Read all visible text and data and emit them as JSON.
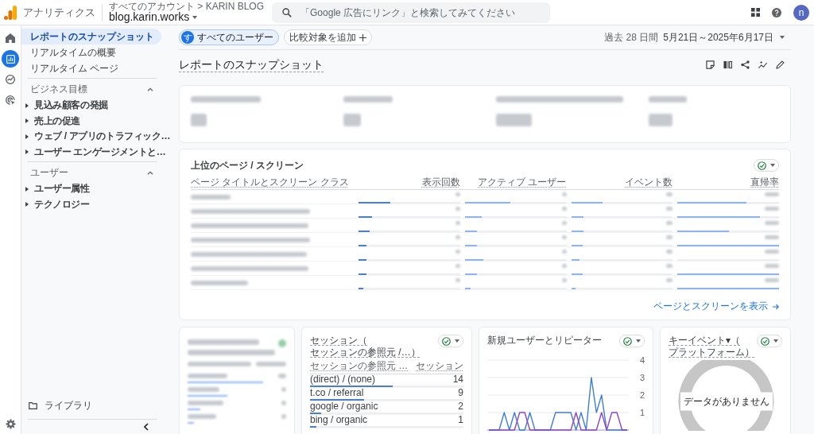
{
  "top_bar": {
    "product": "アナリティクス",
    "account_path": "すべてのアカウント > KARIN BLOG",
    "property": "blog.karin.works",
    "search": {
      "placeholder": "「Google 広告にリンク」と検索してみてください"
    },
    "avatar_letter": "n"
  },
  "rail": {
    "items": [
      {
        "kind": "home",
        "selected": false
      },
      {
        "kind": "reports",
        "selected": true
      },
      {
        "kind": "explore",
        "selected": false
      },
      {
        "kind": "advertising",
        "selected": false
      }
    ]
  },
  "sidebar": {
    "items": [
      {
        "label": "レポートのスナップショット",
        "selected": true
      },
      {
        "label": "リアルタイムの概要",
        "selected": false
      },
      {
        "label": "リアルタイム ページ",
        "selected": false
      }
    ],
    "sections": [
      {
        "title": "ビジネス目標",
        "expanded": true,
        "items": [
          {
            "label": "見込み顧客の発掘",
            "expanded": false
          },
          {
            "label": "売上の促進",
            "expanded": false
          },
          {
            "label": "ウェブ / アプリのトラフィック…",
            "expanded": false
          },
          {
            "label": "ユーザー エンゲージメントと…",
            "expanded": false
          }
        ]
      },
      {
        "title": "ユーザー",
        "expanded": true,
        "items": [
          {
            "label": "ユーザー属性",
            "expanded": false
          },
          {
            "label": "テクノロジー",
            "expanded": false
          }
        ]
      }
    ],
    "library": "ライブラリ"
  },
  "header": {
    "segment": {
      "letter": "す",
      "label": "すべてのユーザー"
    },
    "compare_button": "比較対象を追加",
    "date_preset": "過去 28 日間",
    "date_range": "5月21日～2025年6月17日",
    "title": "レポートのスナップショット"
  },
  "top_pages": {
    "title": "上位のページ / スクリーン",
    "columns": [
      "ページ タイトルとスクリーン クラス",
      "表示回数",
      "アクティブ ユーザー",
      "イベント数",
      "直帰率"
    ],
    "rows": [
      {
        "bars": [
          {
            "level": 0.31
          },
          {
            "level": 0.45
          },
          {
            "level": 0.31
          },
          {
            "level": 0.68
          }
        ]
      },
      {
        "bars": [
          {
            "level": 0.13
          },
          {
            "level": 0.17
          },
          {
            "level": 0.12
          },
          {
            "level": 0.81
          }
        ]
      },
      {
        "bars": [
          {
            "level": 0.11
          },
          {
            "level": 0.12
          },
          {
            "level": 0.12
          },
          {
            "level": 0.51
          }
        ]
      },
      {
        "bars": [
          {
            "level": 0.08
          },
          {
            "level": 0.12
          },
          {
            "level": 0.11
          },
          {
            "level": 1.0
          }
        ]
      },
      {
        "bars": [
          {
            "level": 0.08
          },
          {
            "level": 0.18
          },
          {
            "level": 0.08
          }
        ]
      },
      {
        "bars": [
          {
            "level": 0.08
          },
          {
            "level": 0.12
          },
          {
            "level": 0.11
          },
          {
            "level": 1.0
          }
        ]
      },
      {
        "bars": [
          {
            "level": 0.05
          },
          {
            "level": 0.06
          },
          {
            "level": 0.04
          },
          {
            "level": 1.0
          }
        ]
      }
    ],
    "link": "ページとスクリーンを表示"
  },
  "sessions_card": {
    "title_lines": [
      "セッション（",
      "セッションの参照元 /…）"
    ],
    "columns": [
      "セッションの参照元 …",
      "セッション"
    ],
    "rows": [
      {
        "source": "(direct) / (none)",
        "sessions": "14",
        "level": 0.54
      },
      {
        "source": "t.co / referral",
        "sessions": "9",
        "level": 0.35
      },
      {
        "source": "google / organic",
        "sessions": "2",
        "level": 0.07
      },
      {
        "source": "bing / organic",
        "sessions": "1",
        "level": 0.04
      }
    ]
  },
  "new_returning_card": {
    "title": "新規ユーザーとリピーター",
    "chart_data": {
      "type": "line",
      "ylim": [
        0,
        4
      ],
      "yticks": [
        1,
        2,
        3,
        4
      ],
      "grid": true,
      "series": [
        {
          "color": "#3f7fd0",
          "values": [
            0,
            0,
            0,
            1,
            0,
            1,
            0,
            0,
            1,
            0,
            0,
            0,
            0,
            1,
            1,
            1,
            1,
            0,
            1,
            0,
            3,
            1,
            2,
            0,
            0,
            0,
            0,
            0
          ]
        },
        {
          "color": "#8e44c9",
          "values": [
            0,
            0,
            0,
            0,
            0,
            0,
            1,
            1,
            0,
            0,
            0,
            0,
            0,
            0,
            0,
            0,
            0,
            1,
            0,
            0,
            0,
            0,
            1,
            0,
            1,
            1,
            0,
            0
          ]
        }
      ]
    }
  },
  "key_events_card": {
    "title_lines": [
      "キーイベント▾（",
      "プラットフォーム）"
    ],
    "empty_message": "データがありません"
  }
}
